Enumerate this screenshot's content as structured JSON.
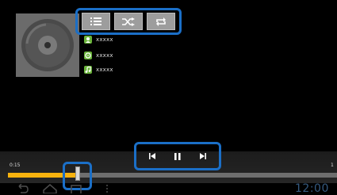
{
  "toolbar": {
    "buttons": [
      {
        "icon": "playlist-icon"
      },
      {
        "icon": "shuffle-icon"
      },
      {
        "icon": "repeat-icon"
      }
    ]
  },
  "track_info": [
    {
      "icon": "artist-icon",
      "text": "xxxxx"
    },
    {
      "icon": "album-icon",
      "text": "xxxxx"
    },
    {
      "icon": "genre-icon",
      "text": "xxxxx"
    }
  ],
  "player": {
    "elapsed": "0:15",
    "total": "1",
    "progress": 0.22
  },
  "controls": [
    {
      "icon": "previous-icon"
    },
    {
      "icon": "pause-icon"
    },
    {
      "icon": "next-icon"
    }
  ],
  "status_bar": {
    "clock": "12:00"
  },
  "colors": {
    "highlight": "#1b6fc7",
    "progress": "#f7b20e",
    "info_icon": "#6ab43a"
  }
}
